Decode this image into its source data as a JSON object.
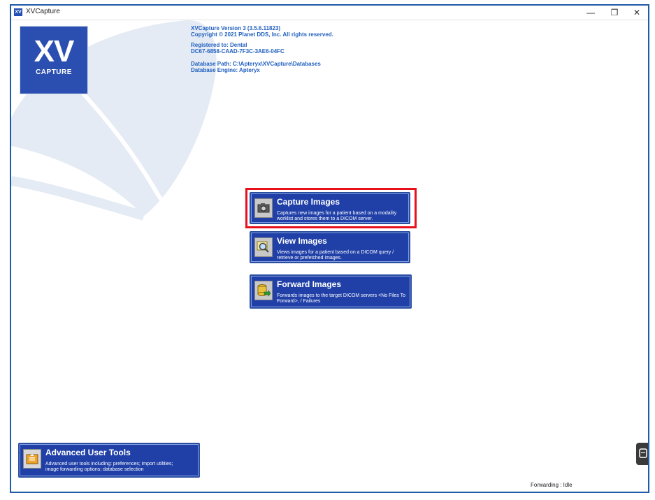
{
  "window": {
    "title": "XVCapture",
    "title_icon": "XV",
    "minimize_glyph": "—",
    "maximize_glyph": "❐",
    "close_glyph": "✕"
  },
  "logo": {
    "main": "XV",
    "sub": "CAPTURE"
  },
  "info": {
    "version": "XVCapture Version 3 (3.5.6.11823)",
    "copyright": "Copyright © 2021 Planet DDS, Inc. All rights reserved.",
    "registered_to": "Registered to: Dental",
    "registration_code": "DC67-6858-CAAD-7F3C-3AE6-04FC",
    "database_path": "Database Path: C:\\Apteryx\\XVCapture\\Databases",
    "database_engine": "Database Engine: Apteryx"
  },
  "actions": {
    "capture": {
      "label": "Capture Images",
      "description": "Captures new images for a patient based on a modality worklist and stores them to a DICOM server."
    },
    "view": {
      "label": "View Images",
      "description": "Views images for a patient based on a DICOM query / retrieve or prefetched images."
    },
    "forward": {
      "label": "Forward Images",
      "description": "Forwards images to the target DICOM servers <No Files To Forward>, / Failures"
    },
    "advanced": {
      "label": "Advanced User Tools",
      "description": "Advanced user tools including: preferences; import utilities; image forwarding options; database selection"
    }
  },
  "status": {
    "forwarding": "Forwarding : Idle"
  },
  "colors": {
    "accent_blue": "#2040a8",
    "info_text": "#1f5fbf",
    "highlight_red": "#e8101a",
    "border_blue": "#1e5aa8"
  },
  "icons": {
    "capture": "camera-icon",
    "view": "magnifier-image-icon",
    "forward": "database-forward-icon",
    "advanced": "toolbox-icon",
    "side_tab": "panel-tab-icon"
  }
}
